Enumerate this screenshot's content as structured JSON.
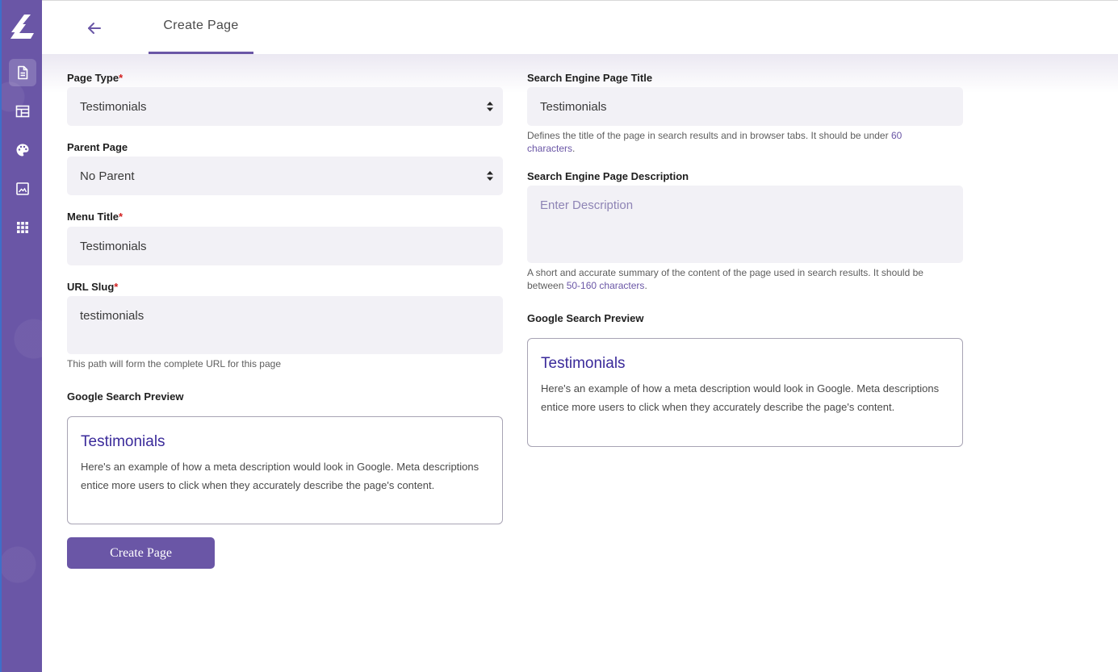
{
  "colors": {
    "accent": "#6a56a6",
    "required": "#d22020",
    "preview_title": "#3a2a9a"
  },
  "sidebar": {
    "items": [
      {
        "icon": "document-icon",
        "active": true
      },
      {
        "icon": "layout-icon",
        "active": false
      },
      {
        "icon": "palette-icon",
        "active": false
      },
      {
        "icon": "image-icon",
        "active": false
      },
      {
        "icon": "apps-grid-icon",
        "active": false
      }
    ]
  },
  "header": {
    "back_icon": "arrow-left-icon",
    "tab_label": "Create Page"
  },
  "form_left": {
    "page_type": {
      "label": "Page Type",
      "required": "*",
      "value": "Testimonials"
    },
    "parent_page": {
      "label": "Parent Page",
      "value": "No Parent"
    },
    "menu_title": {
      "label": "Menu Title",
      "required": "*",
      "value": "Testimonials"
    },
    "url_slug": {
      "label": "URL Slug",
      "required": "*",
      "value": "testimonials",
      "hint": "This path will form the complete URL for this page"
    },
    "preview": {
      "heading": "Google Search Preview",
      "title": "Testimonials",
      "description": "Here's an example of how a meta description would look in Google. Meta descriptions entice more users to click when they accurately describe the page's content."
    },
    "submit_label": "Create Page"
  },
  "form_right": {
    "seo_title": {
      "label": "Search Engine Page Title",
      "value": "Testimonials",
      "hint_prefix": "Defines the title of the page in search results and in browser tabs. It should be under ",
      "hint_accent": "60 characters",
      "hint_suffix": "."
    },
    "seo_description": {
      "label": "Search Engine Page Description",
      "placeholder": "Enter Description",
      "hint_prefix": "A short and accurate summary of the content of the page used in search results. It should be between ",
      "hint_accent": "50-160 characters",
      "hint_suffix": "."
    },
    "preview": {
      "heading": "Google Search Preview",
      "title": "Testimonials",
      "description": "Here's an example of how a meta description would look in Google. Meta descriptions entice more users to click when they accurately describe the page's content."
    }
  }
}
